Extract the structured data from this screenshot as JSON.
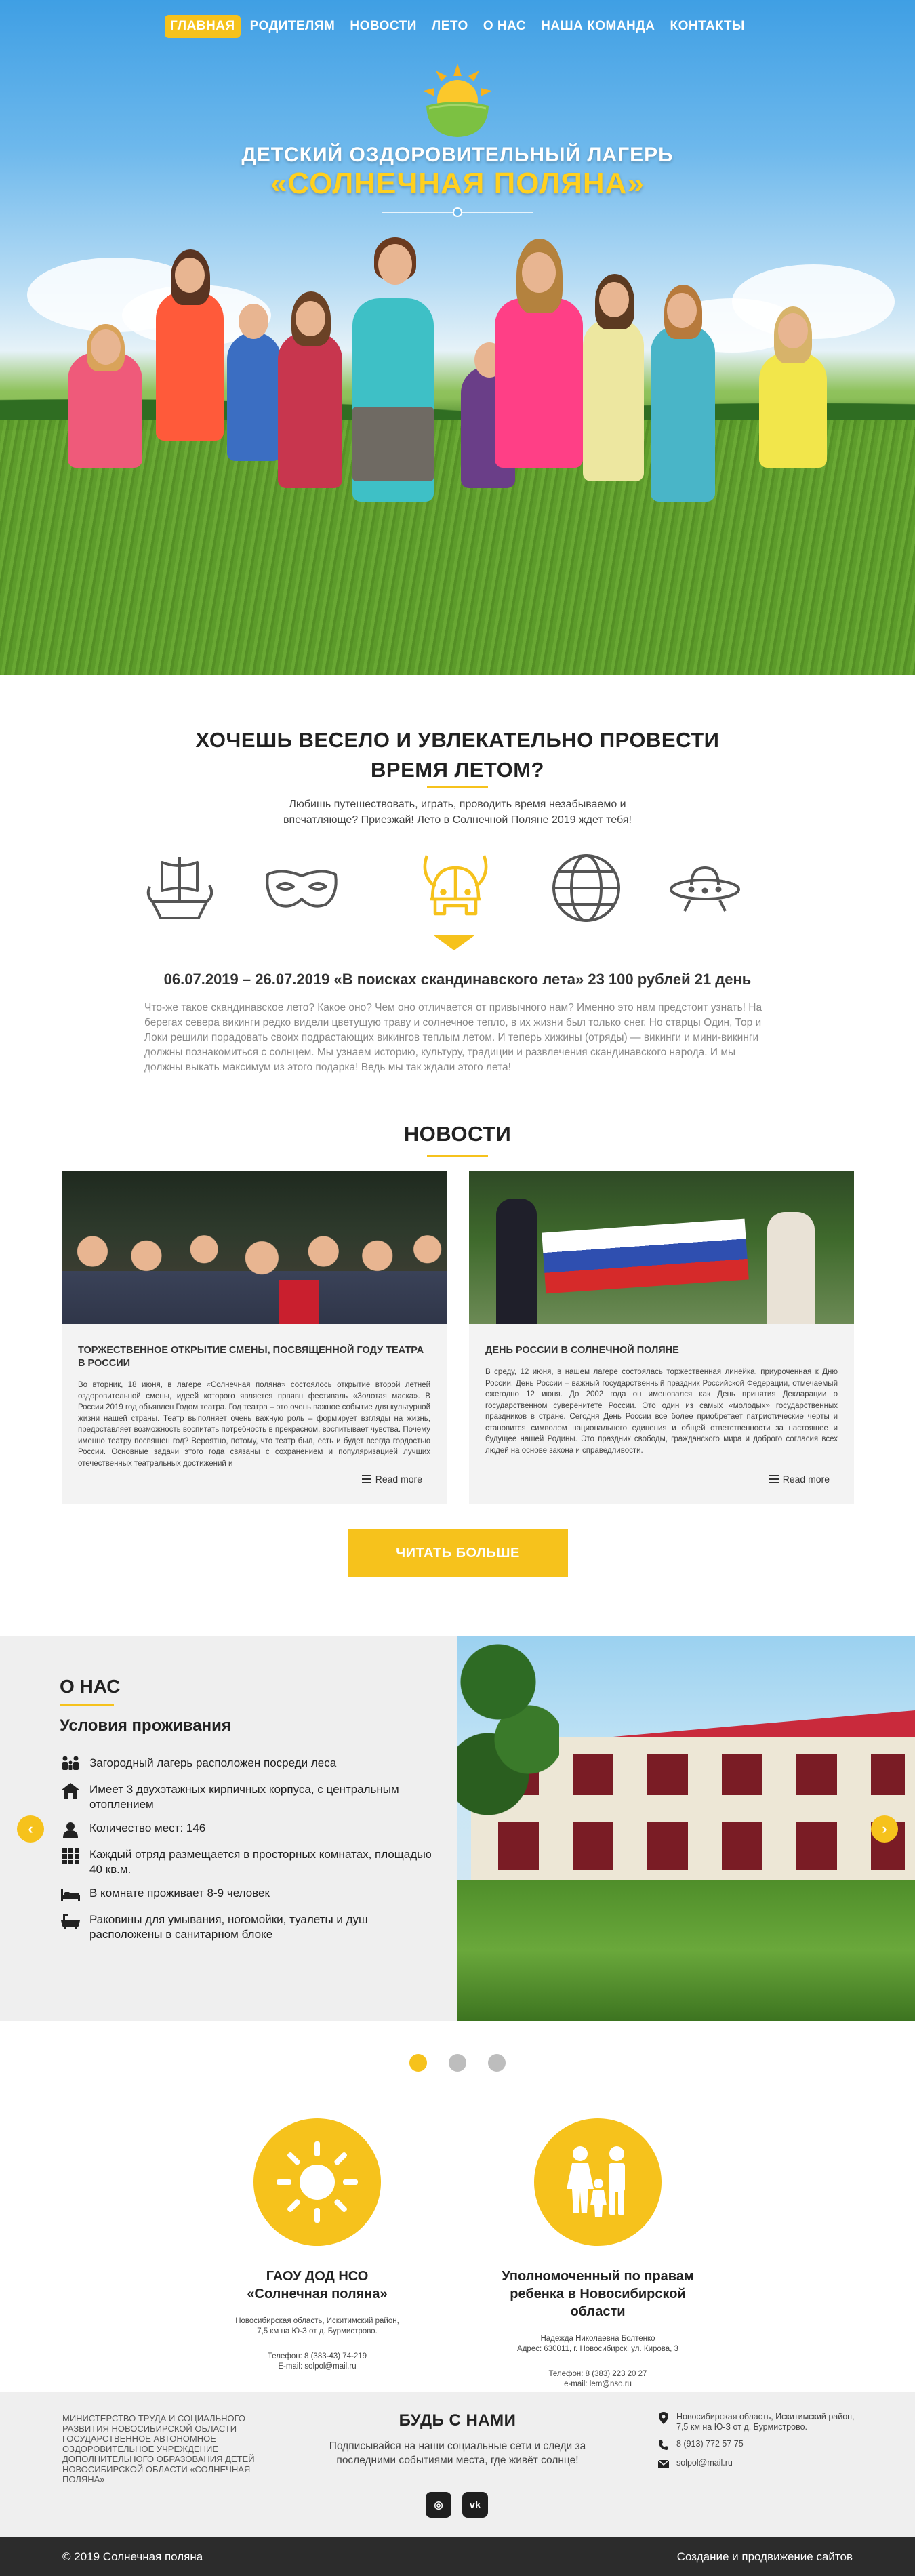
{
  "nav": {
    "items": [
      {
        "label": "ГЛАВНАЯ",
        "active": true
      },
      {
        "label": "РОДИТЕЛЯМ",
        "active": false
      },
      {
        "label": "НОВОСТИ",
        "active": false
      },
      {
        "label": "ЛЕТО",
        "active": false
      },
      {
        "label": "О НАС",
        "active": false
      },
      {
        "label": "НАША КОМАНДА",
        "active": false
      },
      {
        "label": "КОНТАКТЫ",
        "active": false
      }
    ]
  },
  "hero": {
    "title_line1": "ДЕТСКИЙ ОЗДОРОВИТЕЛЬНЫЙ ЛАГЕРЬ",
    "title_line2": "«СОЛНЕЧНАЯ ПОЛЯНА»"
  },
  "intro": {
    "title_line1": "ХОЧЕШЬ ВЕСЕЛО И УВЛЕКАТЕЛЬНО ПРОВЕСТИ",
    "title_line2": "ВРЕМЯ ЛЕТОМ?",
    "subtitle": "Любишь путешествовать, играть, проводить время незабываемо и впечатляюще? Приезжай! Лето в Солнечной Поляне 2019 ждет тебя!",
    "theme_icons": [
      "viking-ship-icon",
      "mask-icon",
      "viking-helmet-icon",
      "globe-icon",
      "ufo-icon"
    ],
    "selected_icon": 2,
    "shift_title": "06.07.2019 – 26.07.2019 «В поисках скандинавского лета» 23 100 рублей 21 день",
    "shift_text": "Что-же такое скандинавское лето? Какое оно? Чем оно отличается от привычного нам? Именно это нам предстоит узнать! На берегах севера викинги редко видели цветущую траву и солнечное тепло, в их жизни был только снег. Но старцы Один, Тор и Локи решили порадовать своих подрастающих викингов теплым летом. И теперь хижины (отряды) — викинги и мини-викинги должны познакомиться с солнцем. Мы узнаем историю, культуру, традиции и развлечения скандинавского народа. И мы должны выкать максимум из этого подарка! Ведь мы так ждали этого лета!"
  },
  "news": {
    "title": "НОВОСТИ",
    "read_more_label": "Read more",
    "items": [
      {
        "headline": "ТОРЖЕСТВЕННОЕ ОТКРЫТИЕ СМЕНЫ, ПОСВЯЩЕННОЙ ГОДУ ТЕАТРА В РОССИИ",
        "text": "Во вторник, 18 июня, в лагере «Солнечная поляна» состоялось открытие второй летней оздоровительной смены, идеей которого является првявн фестиваль «Золотая маска». В России 2019 год объявлен Годом театра. Год театра – это очень важное событие для культурной жизни нашей страны. Театр выполняет очень важную роль – формирует взгляды на жизнь, предоставляет возможность воспитать потребность в прекрасном, воспитывает чувства. Почему именно театру посвящен год? Вероятно, потому, что театр был, есть и будет всегда гордостью России. Основные задачи этого года связаны с сохранением и популяризацией лучших отечественных театральных достижений и"
      },
      {
        "headline": "ДЕНЬ РОССИИ В СОЛНЕЧНОЙ ПОЛЯНЕ",
        "text": "В среду, 12 июня, в нашем лагере состоялась торжественная линейка, приуроченная к Дню России. День России – важный государственный праздник Российской Федерации, отмечаемый ежегодно 12 июня. До 2002 года он именовался как День принятия Декларации о государственном суверенитете России. Это один из самых «молодых» государственных праздников в стране. Сегодня День России все более приобретает патриотические черты и становится символом национального единения и общей ответственности за настоящее и будущее нашей Родины. Это праздник свободы, гражданского мира и доброго согласия всех людей на основе закона и справедливости."
      }
    ],
    "more_button": "ЧИТАТЬ БОЛЬШЕ"
  },
  "about": {
    "title": "О НАС",
    "subtitle": "Условия проживания",
    "items": [
      {
        "icon": "family-icon",
        "text": "Загородный лагерь расположен посреди леса"
      },
      {
        "icon": "building-icon",
        "text": "Имеет 3 двухэтажных кирпичных корпуса, с центральным отоплением"
      },
      {
        "icon": "person-icon",
        "text": "Количество мест: 146"
      },
      {
        "icon": "grid-icon",
        "text": "Каждый отряд  размещается в просторных комнатах, площадью 40 кв.м."
      },
      {
        "icon": "bed-icon",
        "text": "В комнате проживает 8-9 человек"
      },
      {
        "icon": "bathtub-icon",
        "text": "Раковины для умывания, ногомойки, туалеты и душ расположены в санитарном  блоке"
      }
    ],
    "prev_label": "‹",
    "next_label": "›",
    "slides_total": 3,
    "slide_active": 0
  },
  "partners": [
    {
      "icon": "sun-icon",
      "name_line1": "ГАОУ ДОД НСО",
      "name_line2": "«Солнечная поляна»",
      "addr_line1": "Новосибирская область, Искитимский район,",
      "addr_line2": "7,5 км на Ю-З от д. Бурмистрово.",
      "phone": "Телефон: 8 (383-43) 74-219",
      "email": "E-mail: solpol@mail.ru"
    },
    {
      "icon": "family-icon",
      "name_line1": "Уполномоченный по правам",
      "name_line2": "ребенка в Новосибирской области",
      "addr_line1": "Надежда Николаевна Болтенко",
      "addr_line2": "Адрес: 630011, г. Новосибирск, ул. Кирова, 3",
      "phone": "Телефон: 8 (383) 223 20 27",
      "email": "e-mail: lem@nso.ru"
    }
  ],
  "footer": {
    "ministry": "МИНИСТЕРСТВО ТРУДА И СОЦИАЛЬНОГО РАЗВИТИЯ НОВОСИБИРСКОЙ ОБЛАСТИ ГОСУДАРСТВЕННОЕ АВТОНОМНОЕ ОЗДОРОВИТЕЛЬНОЕ УЧРЕЖДЕНИЕ ДОПОЛНИТЕЛЬНОГО ОБРАЗОВАНИЯ ДЕТЕЙ НОВОСИБИРСКОЙ ОБЛАСТИ «СОЛНЕЧНАЯ ПОЛЯНА»",
    "social_title": "БУДЬ С НАМИ",
    "social_text": "Подписывайся на наши социальные сети и следи за последними событиями места, где живёт солнце!",
    "social_instagram": "◎",
    "social_vk": "vk",
    "address": "Новосибирская область, Искитимский район, 7,5 км на Ю-З от д. Бурмистрово.",
    "phone": "8 (913) 772 57 75",
    "email": "solpol@mail.ru",
    "copyright": "© 2019 Солнечная поляна",
    "made_by": "Создание и продвижение сайтов"
  },
  "colors": {
    "accent": "#f6c21c",
    "dark": "#2c2c2c",
    "light_bg": "#efefef"
  }
}
